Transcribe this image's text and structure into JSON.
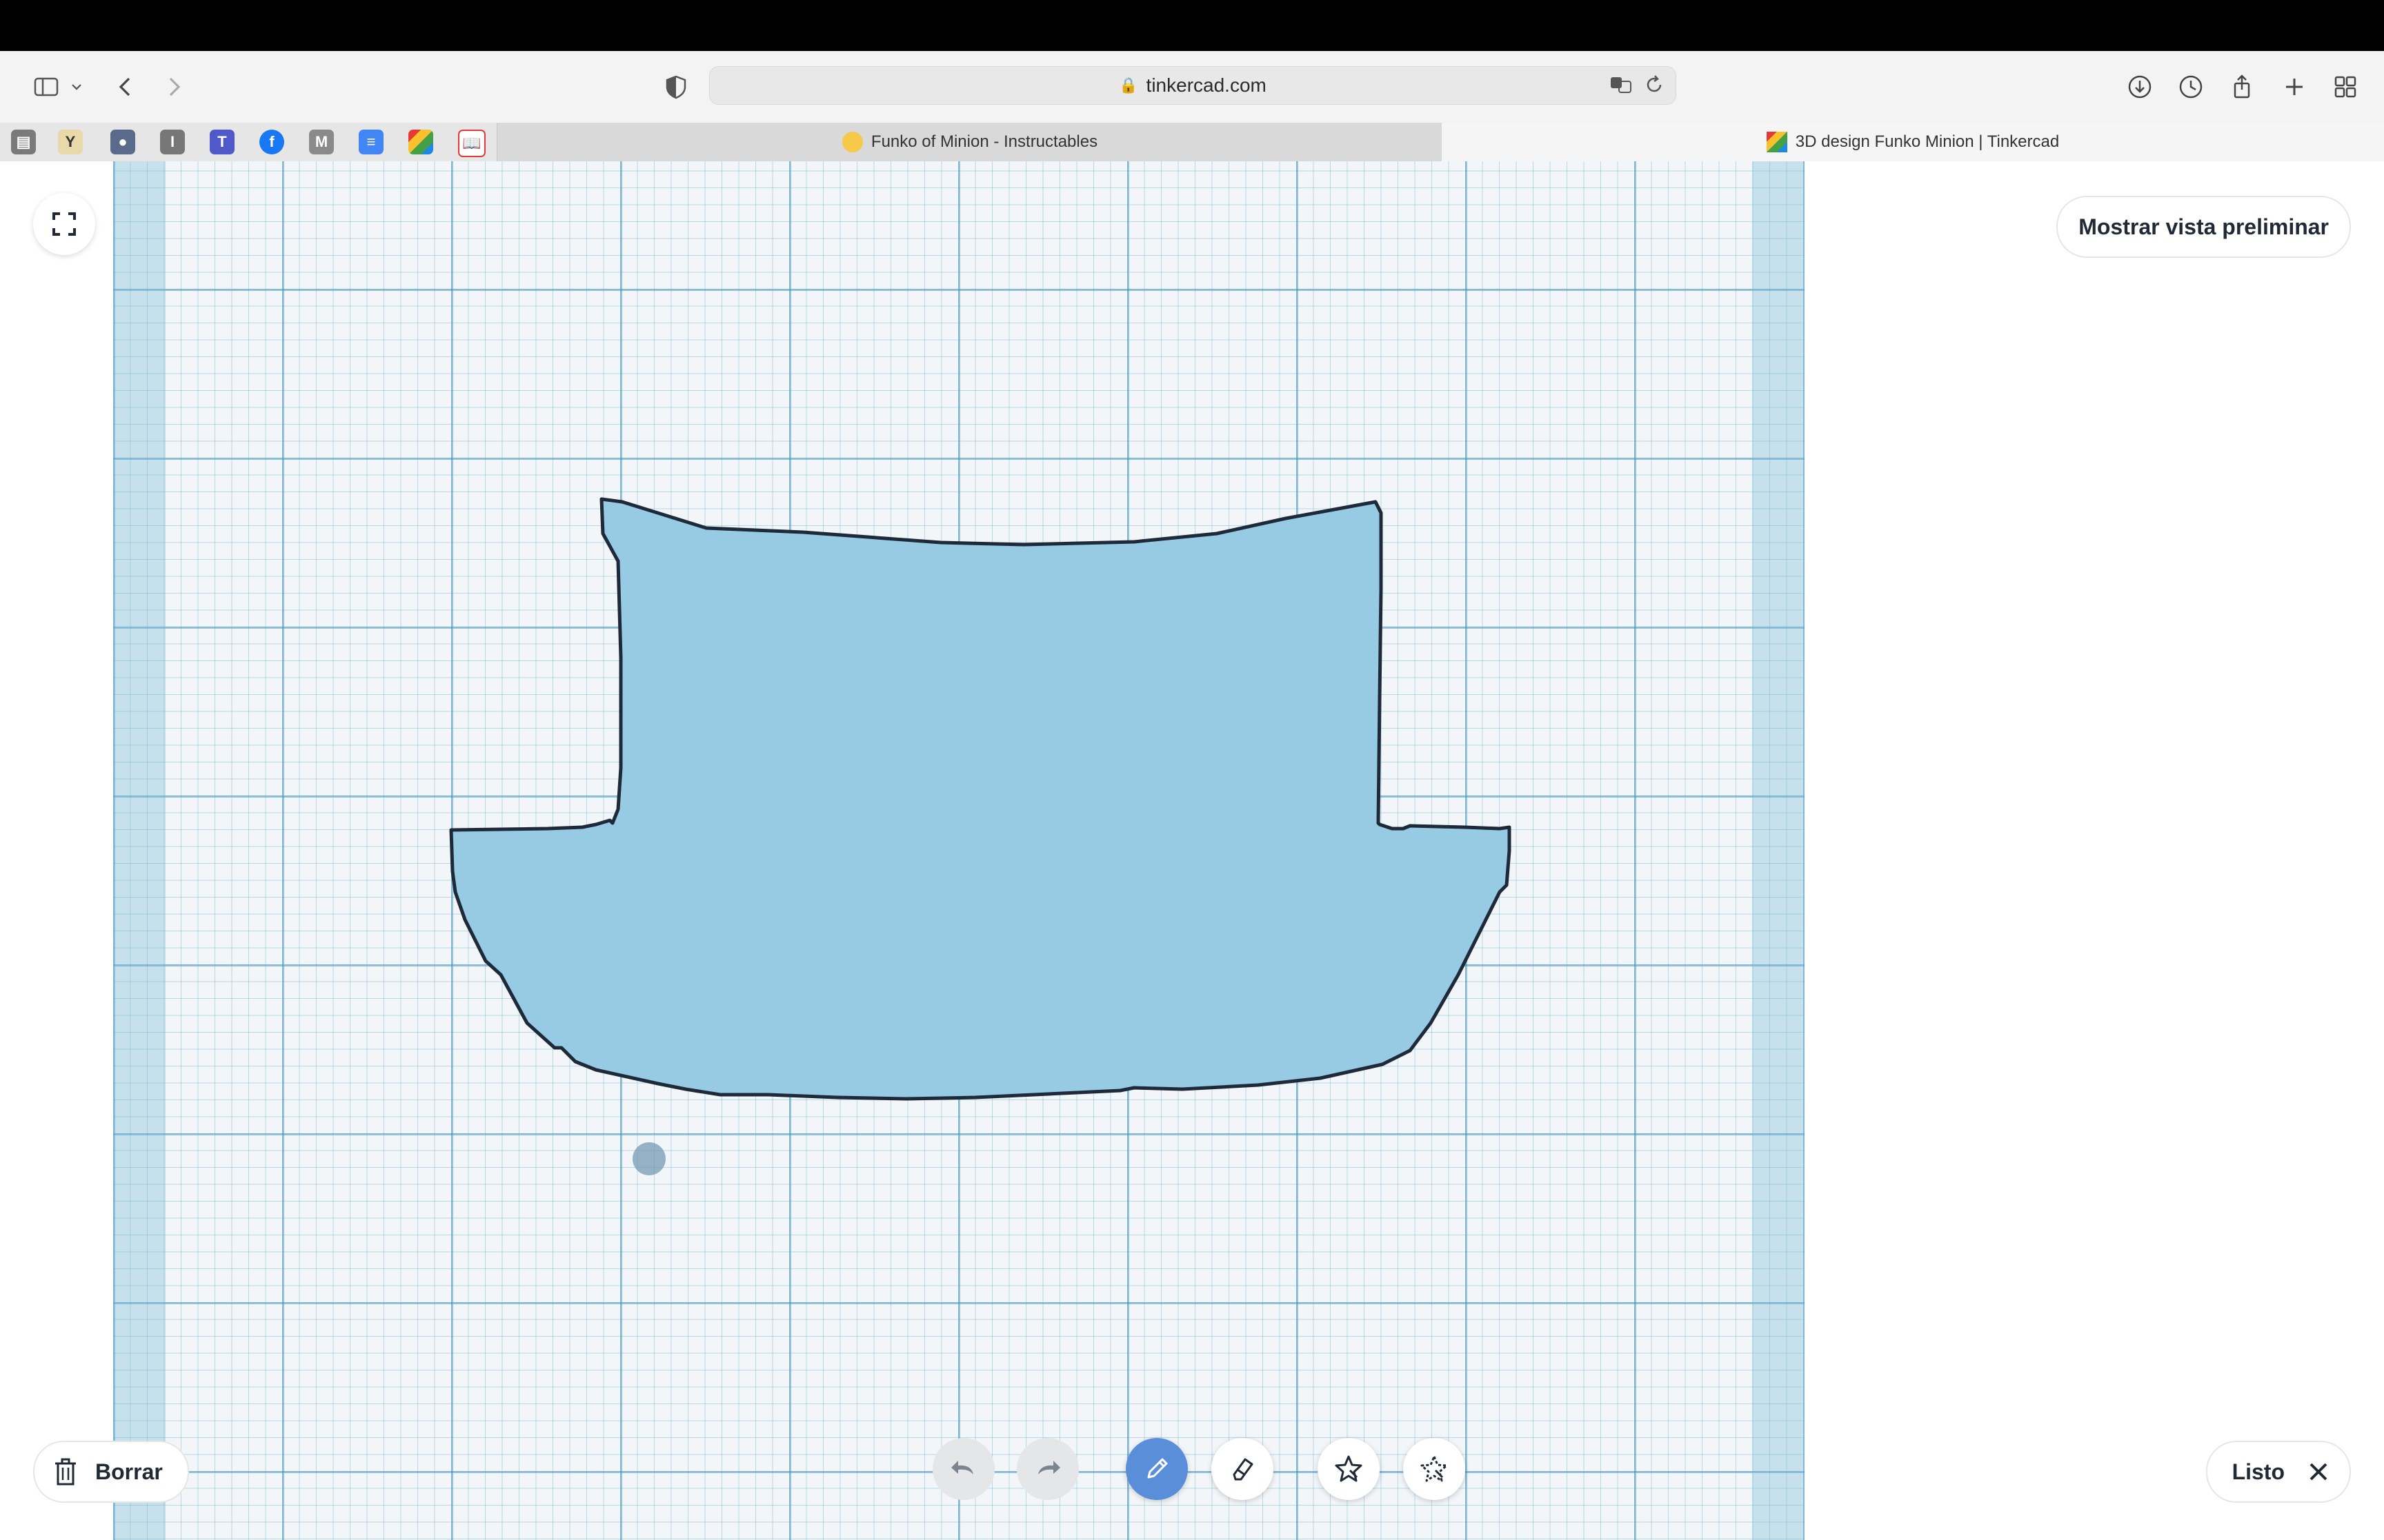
{
  "browser": {
    "url": "tinkercad.com",
    "tabs": [
      {
        "label": "Funko of Minion - Instructables",
        "active": false
      },
      {
        "label": "3D design Funko Minion | Tinkercad",
        "active": true
      }
    ],
    "favorites": [
      "bookmark-1-icon",
      "bookmark-2-icon",
      "bookmark-3-icon",
      "instapaper-icon",
      "teams-icon",
      "facebook-icon",
      "medium-icon",
      "google-docs-icon",
      "tinkercad-icon",
      "books-icon"
    ],
    "favorite_letters": {
      "instapaper": "I",
      "medium": "M"
    }
  },
  "editor": {
    "preview_label": "Mostrar vista preliminar",
    "delete_label": "Borrar",
    "done_label": "Listo",
    "tools": [
      "undo",
      "redo",
      "pencil",
      "eraser",
      "shape-add",
      "shape-subtract"
    ],
    "active_tool": "pencil",
    "colors": {
      "shape_fill": "#97cae3",
      "shape_stroke": "#1e2a3a",
      "accent": "#5b8ed8"
    }
  }
}
